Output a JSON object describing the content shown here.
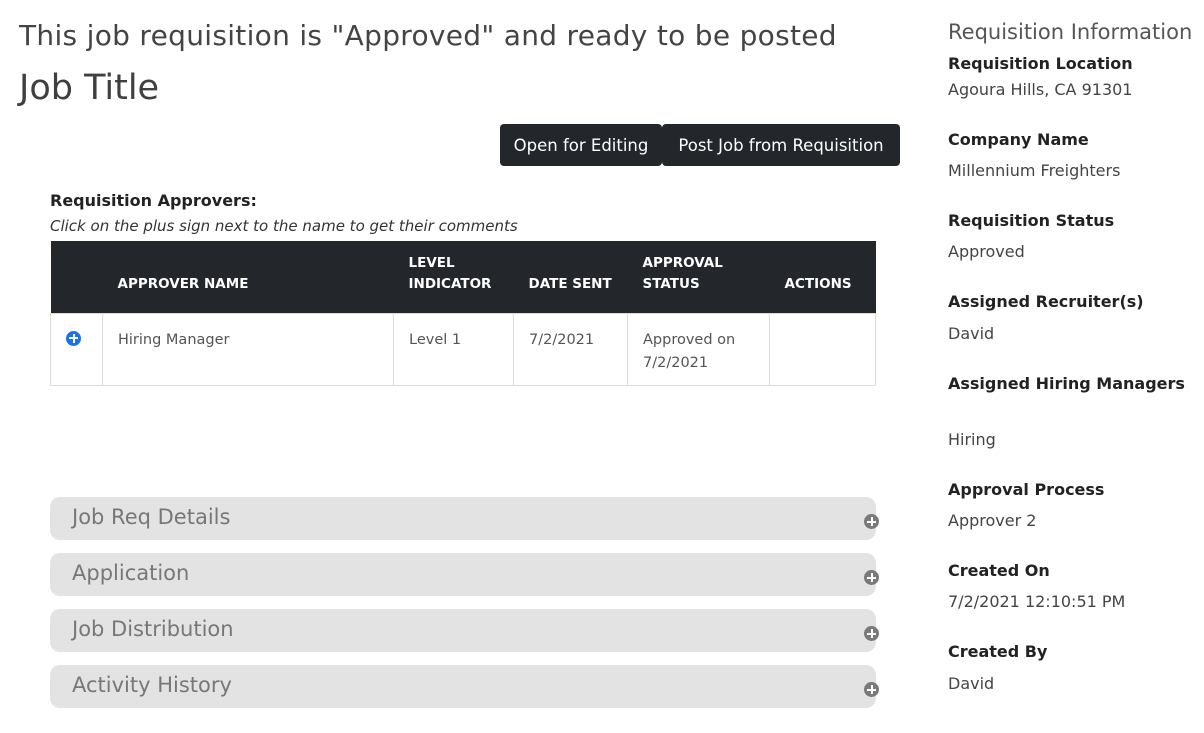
{
  "header": {
    "status_message": "This job requisition is \"Approved\" and ready to be posted",
    "job_title": "Job Title"
  },
  "actions": {
    "open_editing": "Open for Editing",
    "post_job": "Post Job from Requisition"
  },
  "approvers": {
    "label": "Requisition Approvers:",
    "hint": "Click on the plus sign next to the name to get their comments",
    "columns": [
      "",
      "APPROVER NAME",
      "LEVEL INDICATOR",
      "DATE SENT",
      "APPROVAL STATUS",
      "ACTIONS"
    ],
    "rows": [
      {
        "icon": "plus-circle-icon",
        "name": "Hiring Manager",
        "level": "Level 1",
        "date_sent": "7/2/2021",
        "status": "Approved on 7/2/2021",
        "actions": ""
      }
    ]
  },
  "panels": [
    {
      "label": "Job Req Details",
      "icon": "plus-circle-icon"
    },
    {
      "label": "Application",
      "icon": "plus-circle-icon"
    },
    {
      "label": "Job Distribution",
      "icon": "plus-circle-icon"
    },
    {
      "label": "Activity History",
      "icon": "plus-circle-icon"
    }
  ],
  "sidebar": {
    "title": "Requisition Information",
    "fields": [
      {
        "label": "Requisition Location",
        "value": "Agoura Hills, CA 91301"
      },
      {
        "label": "Company Name",
        "value": "Millennium Freighters"
      },
      {
        "label": "Requisition Status",
        "value": "Approved"
      },
      {
        "label": "Assigned Recruiter(s)",
        "value": "David"
      },
      {
        "label": "Assigned Hiring Managers",
        "value": "Hiring"
      },
      {
        "label": "Approval Process",
        "value": "Approver 2"
      },
      {
        "label": "Created On",
        "value": "7/2/2021 12:10:51 PM"
      },
      {
        "label": "Created By",
        "value": "David"
      }
    ]
  },
  "colors": {
    "dark_button": "#23272b",
    "accent_blue": "#1a73e8",
    "panel_bg": "#e3e3e3"
  }
}
